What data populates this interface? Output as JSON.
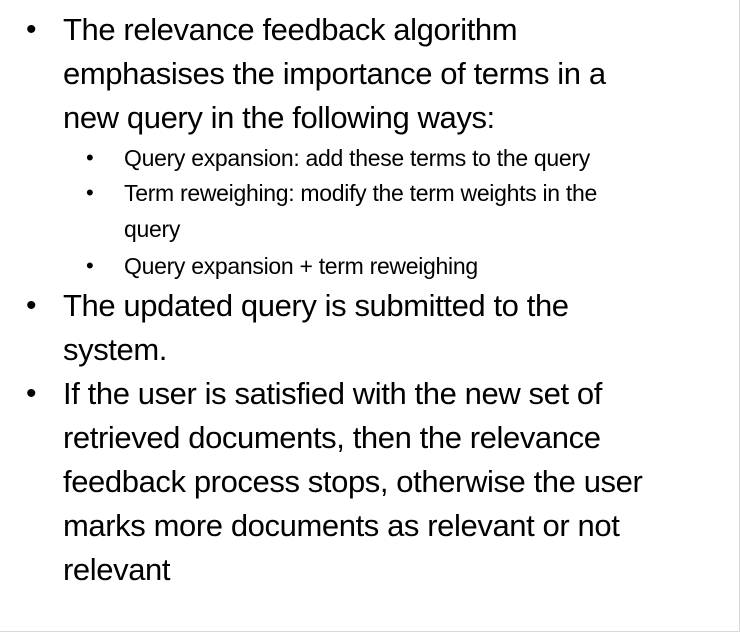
{
  "bullets": [
    {
      "text": "The relevance feedback algorithm emphasises the importance of terms in a new query in the following ways:",
      "lines": [
        "The relevance feedback algorithm",
        "emphasises the importance of terms in a",
        "new query in the following ways:"
      ],
      "sub": [
        {
          "lines": [
            "Query expansion: add these terms to the query"
          ]
        },
        {
          "lines": [
            "Term reweighing: modify the term weights in the",
            "query"
          ]
        },
        {
          "lines": [
            "Query expansion + term reweighing"
          ]
        }
      ]
    },
    {
      "lines": [
        "The updated query is submitted to the",
        "system."
      ]
    },
    {
      "lines": [
        "If the user is satisfied with the new set of",
        "retrieved documents, then the relevance",
        "feedback process stops, otherwise the user",
        "marks more documents as relevant or not",
        "relevant"
      ]
    }
  ],
  "bullet_glyph": "•"
}
